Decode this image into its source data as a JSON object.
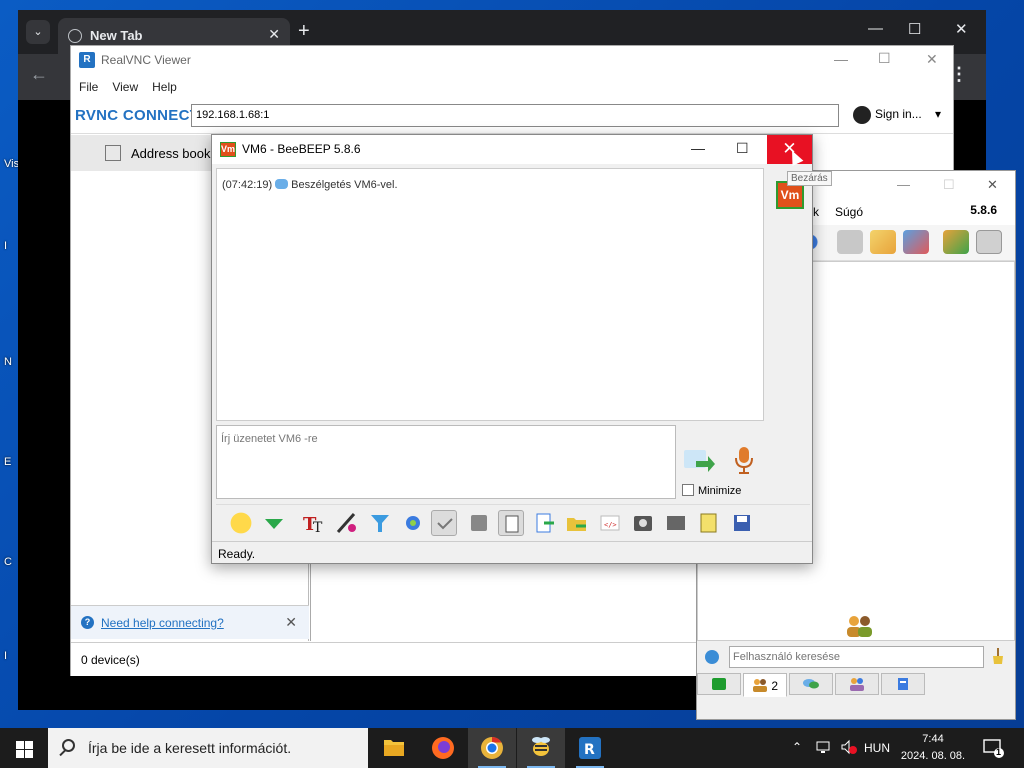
{
  "desktop": {
    "edge_letters": [
      "Vis",
      "I",
      "N",
      "E",
      "C",
      "I"
    ]
  },
  "browser": {
    "tab_title": "New Tab",
    "new_tab_label": "+",
    "tab_close": "✕",
    "dropdown": "⌄",
    "minimize": "—",
    "maximize": "☐",
    "close": "✕",
    "back": "←",
    "menu": "⋮"
  },
  "vnc": {
    "title": "RealVNC Viewer",
    "logo": "R",
    "menu": [
      "File",
      "View",
      "Help"
    ],
    "brand": "RVNC CONNECT",
    "address": "192.168.1.68:1",
    "sign_in": "Sign in...",
    "sign_in_arrow": "▾",
    "address_book": "Address book",
    "help_link": "Need help connecting?",
    "help_close": "✕",
    "status": "0 device(s)",
    "minimize": "—",
    "maximize": "☐",
    "close": "✕"
  },
  "chat": {
    "title": "VM6 - BeeBEEP 5.8.6",
    "icon_text": "Vm",
    "minimize": "—",
    "maximize": "☐",
    "close": "✕",
    "tooltip": "Bezárás",
    "log_time": "(07:42:19)",
    "log_text": "Beszélgetés VM6-vel.",
    "input_placeholder": "Írj üzenetet VM6 -re",
    "minimize_label": "Minimize",
    "status": "Ready."
  },
  "beebeep": {
    "menu_partial": "k",
    "menu_help": "Súgó",
    "version": "5.8.6",
    "minimize": "—",
    "maximize": "☐",
    "close": "✕",
    "search_placeholder": "Felhasználó keresése",
    "users_tab_count": "2"
  },
  "taskbar": {
    "search_placeholder": "Írja be ide a keresett információt.",
    "language": "HUN",
    "time": "7:44",
    "date": "2024. 08. 08.",
    "notification_count": "1"
  },
  "colors": {
    "close_red": "#e81123",
    "vnc_blue": "#2372c2",
    "vm_orange": "#e0501a",
    "vm_green": "#2f9a2f"
  }
}
